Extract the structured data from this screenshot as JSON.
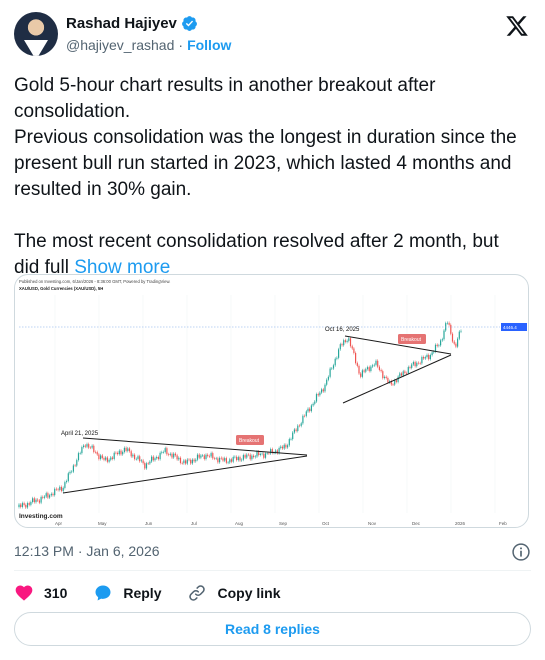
{
  "author": {
    "name": "Rashad Hajiyev",
    "handle": "@hajiyev_rashad",
    "separator": "·",
    "follow_label": "Follow"
  },
  "tweet": {
    "lines": [
      "Gold 5-hour chart results in another breakout after consolidation.",
      "Previous consolidation was the longest in duration since the present bull run started in 2023, which lasted 4 months and resulted in 30% gain.",
      "",
      "The most recent consolidation resolved after 2 month, but did full "
    ],
    "show_more_label": "Show more"
  },
  "chart_image": {
    "header_line1": "Published on Investing.com, 6/Jan/2026 - 8:36:00 GMT, Powered by TradingView.",
    "header_line2": "XAU/USD, Gold Currencies (XAU/USD), 5H",
    "annotation_left": "April 21, 2025",
    "annotation_right": "Oct 16, 2025",
    "breakout_label": "Breakout",
    "watermark": "Investing.com",
    "x_ticks": [
      "Apr",
      "May",
      "Jun",
      "Jul",
      "Aug",
      "Sep",
      "Oct",
      "Nov",
      "Dec",
      "2026",
      "Feb"
    ],
    "current_price_label": "4446.4",
    "colors": {
      "up": "#26a69a",
      "down": "#ef5350",
      "trendline": "#1a1a1a",
      "breakout_box": "#e57373",
      "price_line": "#7aa7e8"
    }
  },
  "meta": {
    "timestamp": "12:13 PM · Jan 6, 2026"
  },
  "actions": {
    "likes": "310",
    "reply_label": "Reply",
    "copy_label": "Copy link"
  },
  "read_replies_label": "Read 8 replies",
  "icons": {
    "verified": "verified-badge-icon",
    "x": "x-logo-icon",
    "info": "info-icon",
    "heart": "heart-icon",
    "reply": "reply-icon",
    "link": "link-icon"
  }
}
